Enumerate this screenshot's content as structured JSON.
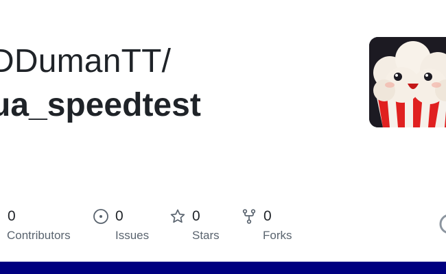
{
  "repo": {
    "owner": "DDumanTT/",
    "name": "ua_speedtest"
  },
  "stats": [
    {
      "count": "0",
      "label": "Contributors",
      "icon": "people-icon"
    },
    {
      "count": "0",
      "label": "Issues",
      "icon": "issue-opened-icon"
    },
    {
      "count": "0",
      "label": "Stars",
      "icon": "star-icon"
    },
    {
      "count": "0",
      "label": "Forks",
      "icon": "repo-forked-icon"
    }
  ],
  "avatar_icon": "popcorn-icon",
  "edge_icon": "github-mark-icon",
  "colors": {
    "text": "#1f2328",
    "muted": "#59636e",
    "accent_bar": "#000080",
    "avatar_bg": "#1c1a22",
    "popcorn_red": "#e02020"
  }
}
